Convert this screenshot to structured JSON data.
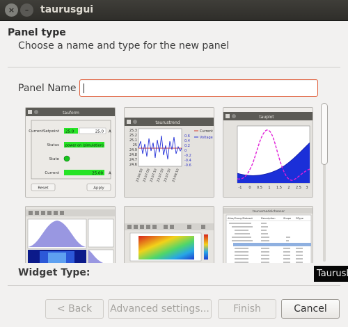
{
  "window": {
    "title": "taurusgui",
    "close_glyph": "×",
    "minimize_glyph": "–"
  },
  "header": {
    "title": "Panel type",
    "subtitle": "Choose a name and type for the new panel"
  },
  "panel_name": {
    "label": "Panel Name",
    "value": ""
  },
  "widget_type": {
    "label": "Widget Type:"
  },
  "tooltip": {
    "text": "TaurusForm"
  },
  "thumbnails": [
    {
      "title": "tauform",
      "rows": [
        {
          "label": "CurrentSetpoint",
          "value": "25.0",
          "readback": "25.0",
          "unit": "A"
        },
        {
          "label": "Status",
          "value": "power on (simulation)"
        },
        {
          "label": "State"
        },
        {
          "label": "Current",
          "value": "25.00",
          "unit": "A"
        }
      ],
      "reset_label": "Reset",
      "apply_label": "Apply"
    },
    {
      "title": "taurustrend",
      "y_ticks": [
        "25.3",
        "25.2",
        "25.1",
        "25",
        "24.9",
        "24.8",
        "24.7",
        "24.6"
      ],
      "y2_ticks": [
        "0.6",
        "0.4",
        "0.2",
        "0",
        "-0.2",
        "-0.4",
        "-0.6"
      ],
      "x_ticks": [
        "23:56:50",
        "23:57:00",
        "23:57:10",
        "23:57:20",
        "23:57:30",
        "23:58:10"
      ],
      "legend": [
        "Current",
        "Voltage"
      ]
    },
    {
      "title": "tauplot",
      "x_ticks": [
        "-1",
        "0",
        "0.5",
        "1",
        "1.5",
        "2",
        "2.5",
        "3"
      ]
    },
    {
      "title": ""
    },
    {
      "title": ""
    },
    {
      "title": "taurusmodelchooser",
      "columns": [
        "Alias/Group/Dataset",
        "Description",
        "Shape",
        "DType"
      ]
    }
  ],
  "buttons": {
    "back": "< Back",
    "advanced": "Advanced settings...",
    "finish": "Finish",
    "cancel": "Cancel"
  },
  "colors": {
    "accent": "#e05e3a",
    "titlebar": "#3f3e39",
    "led_green": "#17c51d"
  }
}
